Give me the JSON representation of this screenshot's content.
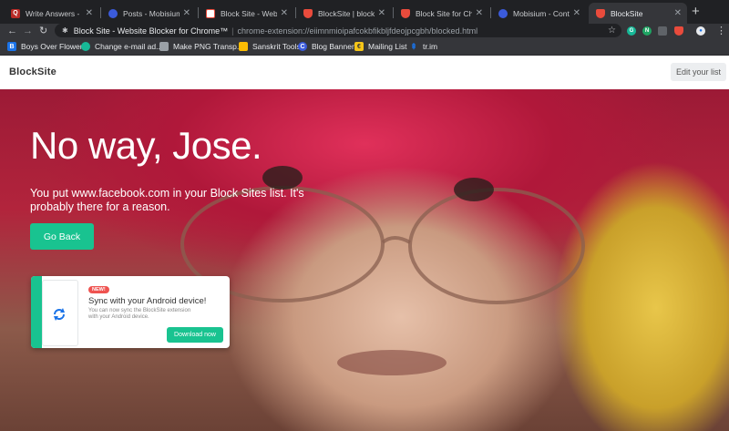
{
  "tabs": [
    {
      "label": "Write Answers - Quora",
      "icon": "quora-icon",
      "color": "#b92b27"
    },
    {
      "label": "Posts - Mobisium — W",
      "icon": "mobisium-icon",
      "color": "#3b5bdb"
    },
    {
      "label": "Block Site - Website B",
      "icon": "blocksite-store-icon",
      "color": "#e94b3c"
    },
    {
      "label": "BlockSite | blocksite.c",
      "icon": "blocksite-shield-icon",
      "color": "#e94b3c"
    },
    {
      "label": "Block Site for Chrome",
      "icon": "blocksite-shield-icon",
      "color": "#e94b3c"
    },
    {
      "label": "Mobisium - Content an",
      "icon": "mobisium-icon",
      "color": "#3b5bdb"
    },
    {
      "label": "BlockSite",
      "icon": "blocksite-shield-icon",
      "color": "#e94b3c",
      "active": true
    }
  ],
  "toolbar": {
    "page_title": "Block Site - Website Blocker for Chrome™",
    "url": "chrome-extension://eiimnmioipafcokbfikbljfdeojpcgbh/blocked.html"
  },
  "bookmarks": [
    {
      "label": "Boys Over Flowers",
      "icon": "bookmark-b-icon",
      "color": "#1a73e8"
    },
    {
      "label": "Change e-mail ad...",
      "icon": "globe-icon",
      "color": "#17b897"
    },
    {
      "label": "Make PNG Transp...",
      "icon": "tools-icon",
      "color": "#9aa0a6"
    },
    {
      "label": "Sanskrit Tools",
      "icon": "sanskrit-icon",
      "color": "#fbbc04"
    },
    {
      "label": "Blog Banner",
      "icon": "canva-icon",
      "color": "#3b5bdb"
    },
    {
      "label": "Mailing List",
      "icon": "mailing-list-icon",
      "color": "#f5c518"
    },
    {
      "label": "tr.im",
      "icon": "trim-icon",
      "color": "#1a73e8"
    }
  ],
  "header": {
    "logo": "BlockSite",
    "edit_label": "Edit your list"
  },
  "hero": {
    "title": "No way, Jose.",
    "message": "You put www.facebook.com in your Block Sites list. It's probably there for a reason.",
    "go_back_label": "Go Back"
  },
  "card": {
    "badge": "NEW!",
    "title": "Sync with your Android device!",
    "description": "You can now sync the BlockSite extension with your Android device.",
    "button_label": "Download now"
  },
  "colors": {
    "accent": "#19c390",
    "tab_bg": "#202124",
    "toolbar_bg": "#35363a"
  }
}
